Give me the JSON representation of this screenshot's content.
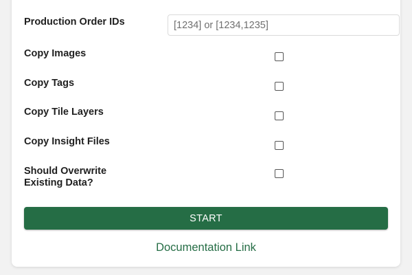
{
  "colors": {
    "accent": "#256d45",
    "link": "#256d45",
    "page_background": "#f2f2f2",
    "card_background": "#ffffff"
  },
  "form": {
    "production_order_ids": {
      "label": "Production Order IDs",
      "value": "",
      "placeholder": "[1234] or [1234,1235]"
    },
    "copy_images": {
      "label": "Copy Images",
      "checked": false
    },
    "copy_tags": {
      "label": "Copy Tags",
      "checked": false
    },
    "copy_tile_layers": {
      "label": "Copy Tile Layers",
      "checked": false
    },
    "copy_insight_files": {
      "label": "Copy Insight Files",
      "checked": false
    },
    "overwrite_existing": {
      "label_line1": "Should Overwrite",
      "label_line2": "Existing Data?",
      "checked": false
    }
  },
  "actions": {
    "start_label": "START",
    "documentation_link_label": "Documentation Link"
  }
}
